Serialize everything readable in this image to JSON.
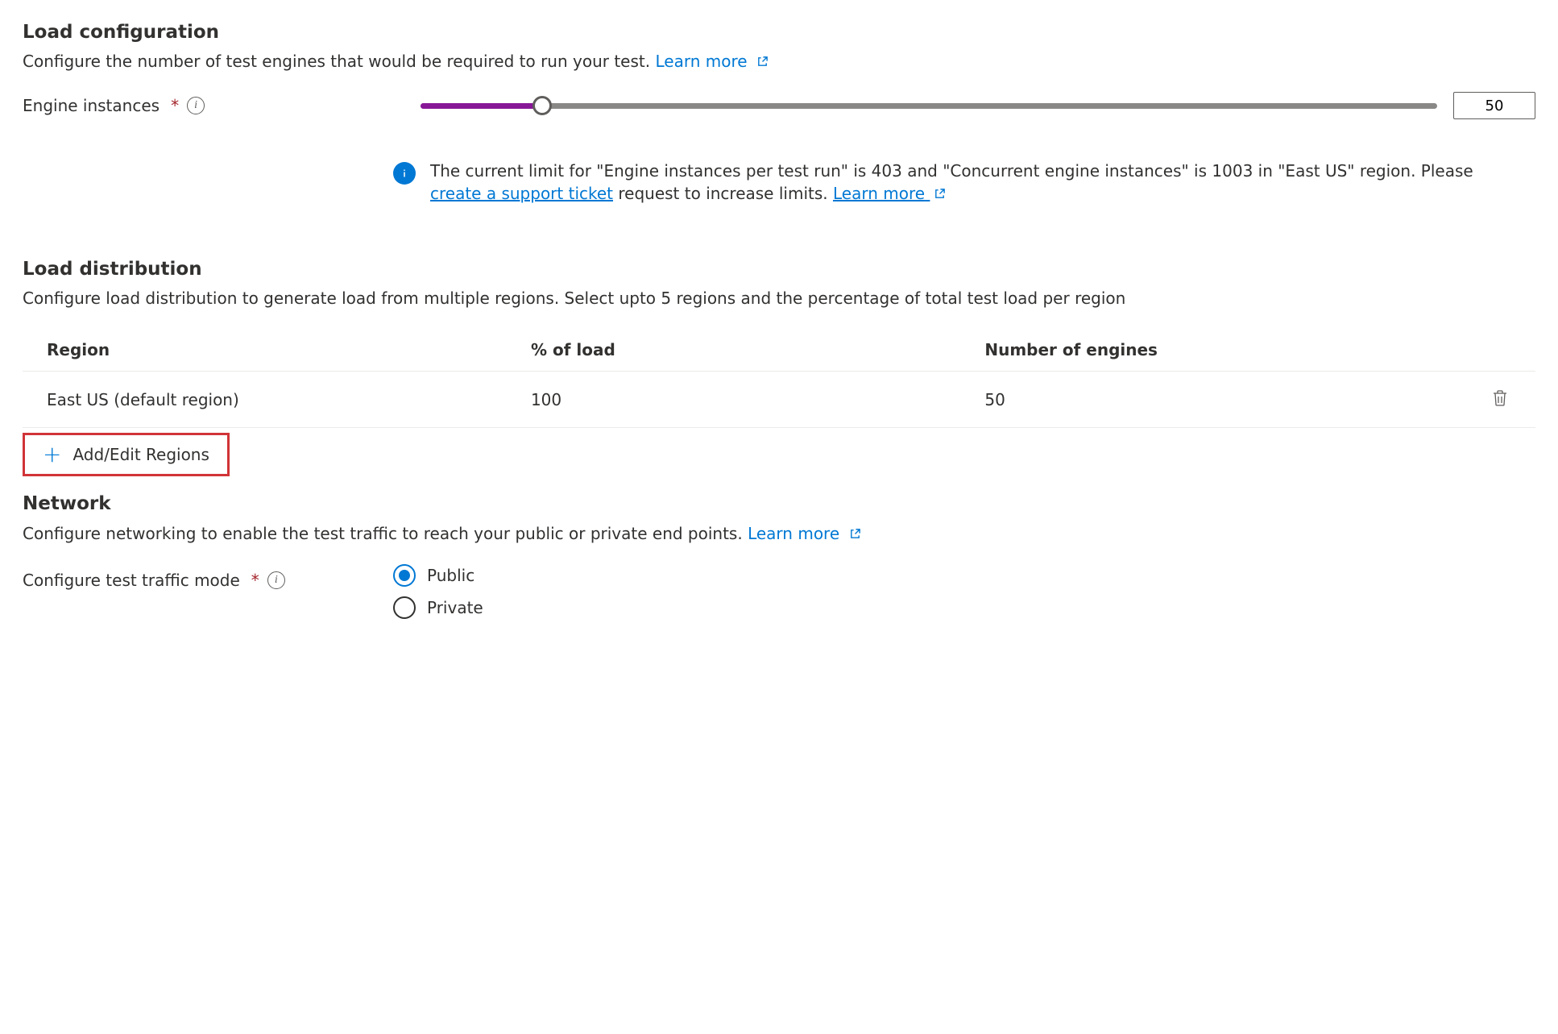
{
  "load_config": {
    "title": "Load configuration",
    "desc": "Configure the number of test engines that would be required to run your test. ",
    "learn_more": "Learn more",
    "engine_label": "Engine instances",
    "engine_value": "50",
    "slider_percent": 12,
    "info_pre": "The current limit for \"Engine instances per test run\" is 403 and \"Concurrent engine instances\" is 1003 in \"East US\" region. Please ",
    "info_link1": "create a support ticket",
    "info_mid": " request to increase limits. ",
    "info_link2": "Learn more"
  },
  "load_dist": {
    "title": "Load distribution",
    "desc": "Configure load distribution to generate load from multiple regions. Select upto 5 regions and the percentage of total test load per region",
    "cols": {
      "region": "Region",
      "pct": "% of load",
      "num": "Number of engines"
    },
    "rows": [
      {
        "region": "East US (default region)",
        "pct": "100",
        "num": "50"
      }
    ],
    "add_label": "Add/Edit Regions"
  },
  "network": {
    "title": "Network",
    "desc": "Configure networking to enable the test traffic to reach your public or private end points. ",
    "learn_more": "Learn more",
    "mode_label": "Configure test traffic mode",
    "opt_public": "Public",
    "opt_private": "Private"
  }
}
